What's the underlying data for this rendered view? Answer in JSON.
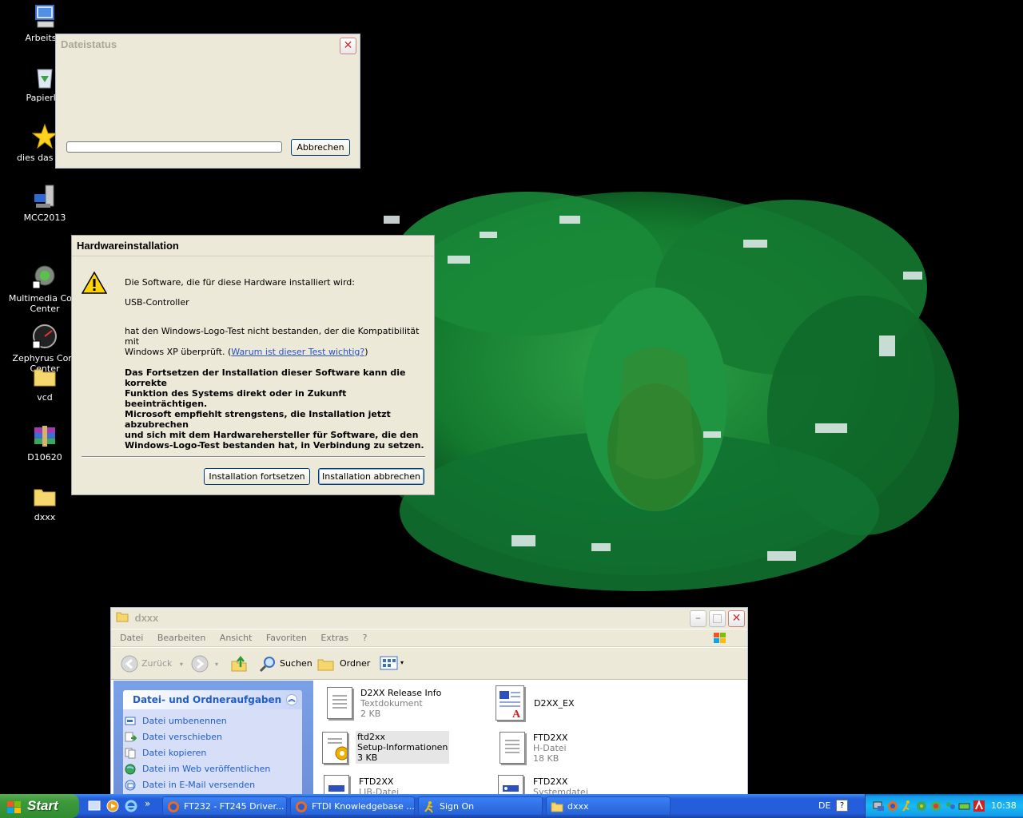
{
  "desktop": {
    "icons": [
      {
        "label": "Arbeitspl",
        "icon": "my-computer-icon"
      },
      {
        "label": "Papierko",
        "icon": "recycle-bin-icon"
      },
      {
        "label": "dies das und",
        "icon": "star-icon"
      },
      {
        "label": "MCC2013",
        "icon": "program-icon"
      },
      {
        "label": "Multimedia Cont\nCenter",
        "icon": "gear-shortcut-icon"
      },
      {
        "label": "Zephyrus Cont\nCenter",
        "icon": "gauge-shortcut-icon"
      },
      {
        "label": "vcd",
        "icon": "folder-icon"
      },
      {
        "label": "D10620",
        "icon": "winrar-archive-icon"
      },
      {
        "label": "dxxx",
        "icon": "folder-icon"
      }
    ]
  },
  "file_status_dialog": {
    "title": "Dateistatus",
    "cancel_label": "Abbrechen",
    "progress": 0
  },
  "hw_dialog": {
    "title": "Hardwareinstallation",
    "line1": "Die Software, die für diese Hardware installiert wird:",
    "device": "USB-Controller",
    "line2a": "hat den Windows-Logo-Test nicht bestanden, der die Kompatibilität mit",
    "line2b": "Windows XP überprüft. (",
    "link": "Warum ist dieser Test wichtig?",
    "line2c": ")",
    "warning": [
      "Das Fortsetzen der Installation dieser Software kann die korrekte",
      "Funktion des Systems direkt oder in Zukunft beeinträchtigen.",
      "Microsoft empfiehlt strengstens, die Installation jetzt abzubrechen",
      "und sich mit dem Hardwarehersteller für Software, die den",
      "Windows-Logo-Test bestanden hat, in Verbindung zu setzen."
    ],
    "continue_label": "Installation fortsetzen",
    "abort_label": "Installation abbrechen"
  },
  "explorer": {
    "title": "dxxx",
    "menu": [
      "Datei",
      "Bearbeiten",
      "Ansicht",
      "Favoriten",
      "Extras",
      "?"
    ],
    "toolbar": {
      "back": "Zurück",
      "search": "Suchen",
      "folders": "Ordner"
    },
    "task_panel": {
      "header": "Datei- und Ordneraufgaben",
      "items": [
        "Datei umbenennen",
        "Datei verschieben",
        "Datei kopieren",
        "Datei im Web veröffentlichen",
        "Datei in E-Mail versenden"
      ]
    },
    "files": [
      {
        "name": "D2XX Release Info",
        "type": "Textdokument",
        "size": "2 KB"
      },
      {
        "name": "D2XX_EX",
        "type": "",
        "size": ""
      },
      {
        "name": "ftd2xx",
        "type": "Setup-Informationen",
        "size": "3 KB"
      },
      {
        "name": "FTD2XX",
        "type": "H-Datei",
        "size": "18 KB"
      },
      {
        "name": "FTD2XX",
        "type": "LIB-Datei",
        "size": ""
      },
      {
        "name": "FTD2XX",
        "type": "Systemdatei",
        "size": ""
      }
    ]
  },
  "taskbar": {
    "start_label": "Start",
    "tasks": [
      "FT232 - FT245 Driver...",
      "FTDI Knowledgebase ...",
      "Sign On",
      "dxxx"
    ],
    "language": "DE",
    "help": "?",
    "clock": "10:38"
  }
}
